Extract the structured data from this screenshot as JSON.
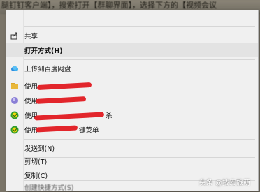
{
  "banner": {
    "text": "腿钉钉客户端】，搜索打开【群聊界面】，选择下方的【视频会议"
  },
  "menu": {
    "share": "共享",
    "open_with": "打开方式(H)",
    "upload_baidu": "上传到百度网盘",
    "use_1": "使用",
    "use_2": "使用",
    "use_3": "使用",
    "use_3_suffix": "杀",
    "use_4": "使用",
    "use_4_suffix": "键菜单",
    "send_to": "发送到(N)",
    "cut": "剪切(T)",
    "copy": "复制(C)",
    "create_shortcut": "创建快捷方式(S)"
  },
  "watermark": {
    "text": "头条 @技宏旅萌"
  },
  "colors": {
    "redaction": "#e2252b",
    "menu_bg": "#f0f0f0"
  }
}
